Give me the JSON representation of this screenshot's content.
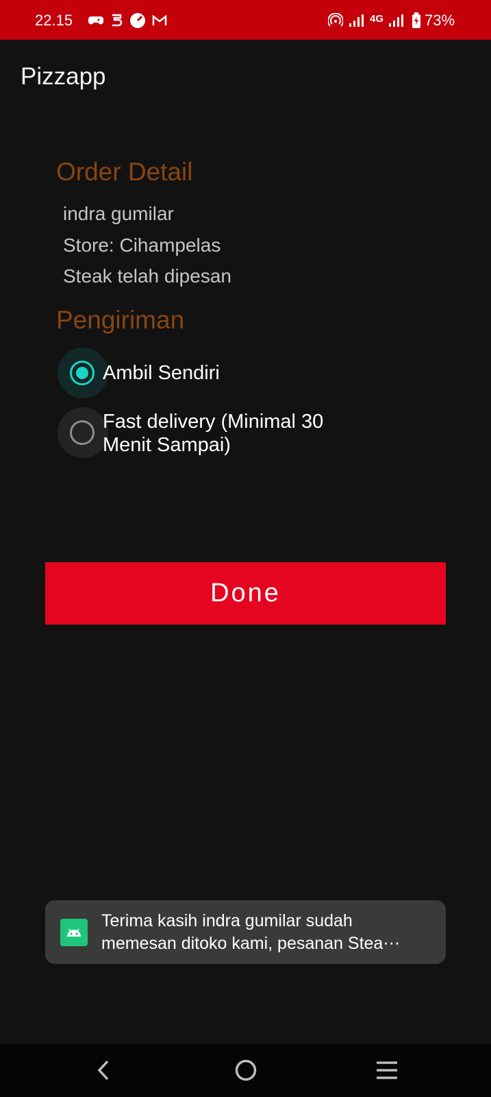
{
  "status_bar": {
    "time": "22.15",
    "network": "4G",
    "battery": "73%",
    "icons": [
      "game-controller-icon",
      "app-5-icon",
      "speedometer-icon",
      "gmail-icon",
      "hotspot-icon",
      "signal-icon",
      "signal-4g-icon",
      "battery-charging-icon"
    ]
  },
  "app_bar": {
    "title": "Pizzapp"
  },
  "order": {
    "title": "Order Detail",
    "name": "indra gumilar",
    "store": "Store: Cihampelas",
    "item": "Steak telah dipesan"
  },
  "shipping": {
    "title": "Pengiriman",
    "options": [
      {
        "label": "Ambil Sendiri",
        "selected": true
      },
      {
        "label_line1": "Fast delivery (Minimal 30",
        "label_line2": "Menit Sampai)",
        "selected": false
      }
    ]
  },
  "done_label": "Done",
  "toast": {
    "line1": "Terima kasih indra gumilar sudah",
    "line2": "memesan ditoko kami, pesanan Stea⋯",
    "icon": "android-icon"
  },
  "nav": [
    "back-icon",
    "home-icon",
    "recents-icon"
  ],
  "colors": {
    "status_bar": "#c4000a",
    "accent": "#e60521",
    "radio": "#19d3c5",
    "section_title": "#8a4511"
  }
}
